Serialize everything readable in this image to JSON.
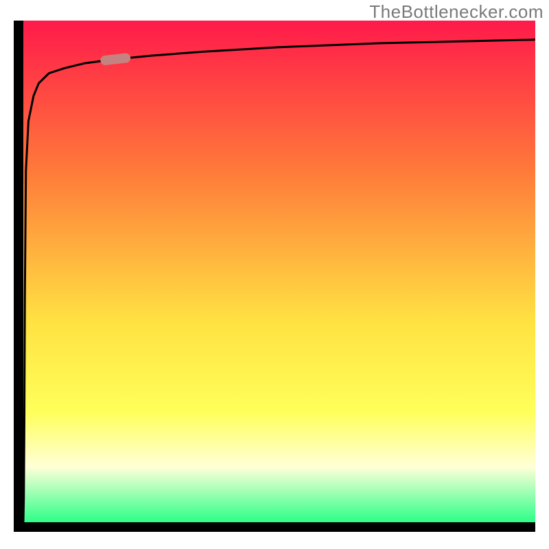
{
  "watermark": "TheBottlenecker.com",
  "colors": {
    "gradient_top": "#ff1a4a",
    "gradient_mid_upper": "#ff7a3a",
    "gradient_mid": "#ffe242",
    "gradient_mid_lower": "#ffff5a",
    "gradient_band": "#ffffd8",
    "gradient_bottom": "#2cff88",
    "curve": "#000000",
    "marker": "#c48380",
    "axis": "#000000"
  },
  "chart_data": {
    "type": "line",
    "title": "",
    "xlabel": "",
    "ylabel": "",
    "xlim": [
      0,
      100
    ],
    "ylim": [
      0,
      100
    ],
    "x": [
      0,
      0.1,
      0.2,
      0.3,
      0.5,
      1,
      2,
      3,
      5,
      8,
      12,
      18,
      25,
      35,
      50,
      70,
      100
    ],
    "values": [
      0,
      5,
      20,
      45,
      70,
      80,
      85,
      87.5,
      89.5,
      90.5,
      91.5,
      92.3,
      93.0,
      93.8,
      94.7,
      95.5,
      96.2
    ],
    "marker_point": {
      "x": 18,
      "y": 92.3
    },
    "note": "Axes unlabeled; values are proportional estimates (0-100). Curve is a steep saturating function (near-vertical initial rise) with a single highlighted segment marker near x≈18%."
  }
}
